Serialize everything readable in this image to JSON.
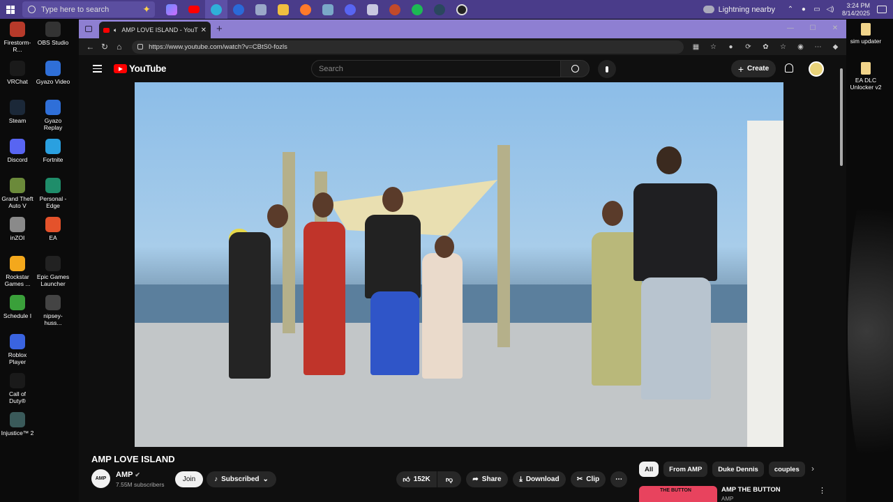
{
  "taskbar": {
    "search_placeholder": "Type here to search",
    "weather": "Lightning nearby",
    "time": "3:24 PM",
    "date": "8/14/2025"
  },
  "desktop_left": [
    {
      "label": "Firestorm-R...",
      "color": "#b73a2a"
    },
    {
      "label": "OBS Studio",
      "color": "#333333"
    },
    {
      "label": "VRChat",
      "color": "#1a1a1a"
    },
    {
      "label": "Gyazo Video",
      "color": "#2f6fd8"
    },
    {
      "label": "Steam",
      "color": "#1b2838"
    },
    {
      "label": "Gyazo Replay",
      "color": "#2f6fd8"
    },
    {
      "label": "Discord",
      "color": "#5865f2"
    },
    {
      "label": "Fortnite",
      "color": "#2aa0e0"
    },
    {
      "label": "Grand Theft Auto V",
      "color": "#6b8a3a"
    },
    {
      "label": "Personal - Edge",
      "color": "#1f8d6a"
    },
    {
      "label": "inZOI",
      "color": "#8a8a8a"
    },
    {
      "label": "EA",
      "color": "#e4522b"
    },
    {
      "label": "Rockstar Games ...",
      "color": "#f4a81c"
    },
    {
      "label": "Epic Games Launcher",
      "color": "#222222"
    },
    {
      "label": "Schedule I",
      "color": "#3aa03a"
    },
    {
      "label": "nipsey-huss...",
      "color": "#444444"
    },
    {
      "label": "Roblox Player",
      "color": "#3a64e0"
    },
    {
      "label": "Call of Duty®",
      "color": "#1a1a1a"
    },
    {
      "label": "Injustice™ 2",
      "color": "#3a5a5a"
    }
  ],
  "desktop_right": [
    {
      "label": "sim updater"
    },
    {
      "label": "EA DLC Unlocker v2"
    }
  ],
  "browser": {
    "tab_title": "AMP LOVE ISLAND - YouTube",
    "url": "https://www.youtube.com/watch?v=CBtS0-fozls"
  },
  "youtube": {
    "logo": "YouTube",
    "search_placeholder": "Search",
    "create_label": "Create",
    "video_title": "AMP LOVE ISLAND",
    "channel_name": "AMP",
    "channel_avatar": "AMP",
    "subscribers": "7.55M subscribers",
    "join_label": "Join",
    "subscribed_label": "Subscribed",
    "likes": "152K",
    "share_label": "Share",
    "download_label": "Download",
    "clip_label": "Clip",
    "chips": [
      "All",
      "From AMP",
      "Duke Dennis",
      "couples"
    ],
    "recommendation": {
      "thumb_text": "THE BUTTON",
      "title": "AMP THE BUTTON",
      "channel": "AMP"
    }
  }
}
